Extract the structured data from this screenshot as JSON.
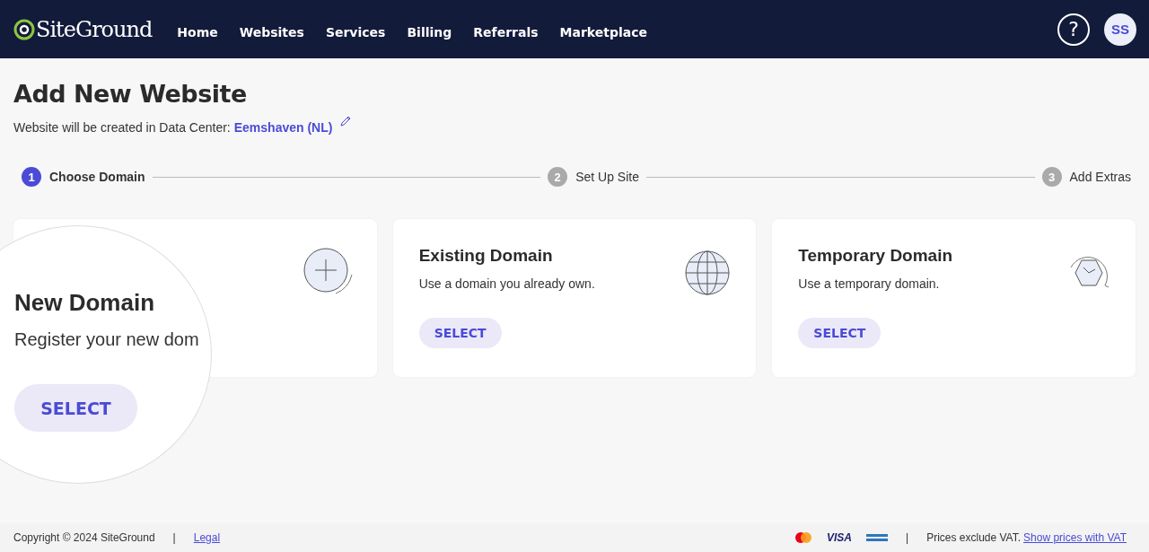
{
  "header": {
    "logo": "SiteGround",
    "nav": [
      {
        "label": "Home"
      },
      {
        "label": "Websites"
      },
      {
        "label": "Services"
      },
      {
        "label": "Billing"
      },
      {
        "label": "Referrals"
      },
      {
        "label": "Marketplace"
      }
    ],
    "help": "?",
    "avatar": "SS"
  },
  "page": {
    "title": "Add New Website",
    "subtitle": "Website will be created in Data Center:",
    "data_center": "Eemshaven (NL)"
  },
  "steps": [
    {
      "number": "1",
      "label": "Choose Domain",
      "selected": true
    },
    {
      "number": "2",
      "label": "Set Up Site",
      "selected": false
    },
    {
      "number": "3",
      "label": "Add Extras",
      "selected": false
    }
  ],
  "cards": [
    {
      "kind": "plus"
    },
    {
      "kind": "globe",
      "title": "Existing Domain",
      "description": "Use a domain you already own.",
      "button": "SELECT"
    },
    {
      "kind": "clock",
      "title": "Temporary Domain",
      "description": "Use a temporary domain.",
      "button": "SELECT"
    }
  ],
  "magnifier": {
    "title": "New Domain",
    "description": "Register your new dom",
    "button": "SELECT"
  },
  "footer": {
    "copyright": "Copyright © 2024 SiteGround",
    "separator": "|",
    "legal": "Legal",
    "visa": "VISA",
    "separator_2": "|",
    "vat_note": "Prices exclude VAT.",
    "vat_link": "Show prices with VAT"
  }
}
